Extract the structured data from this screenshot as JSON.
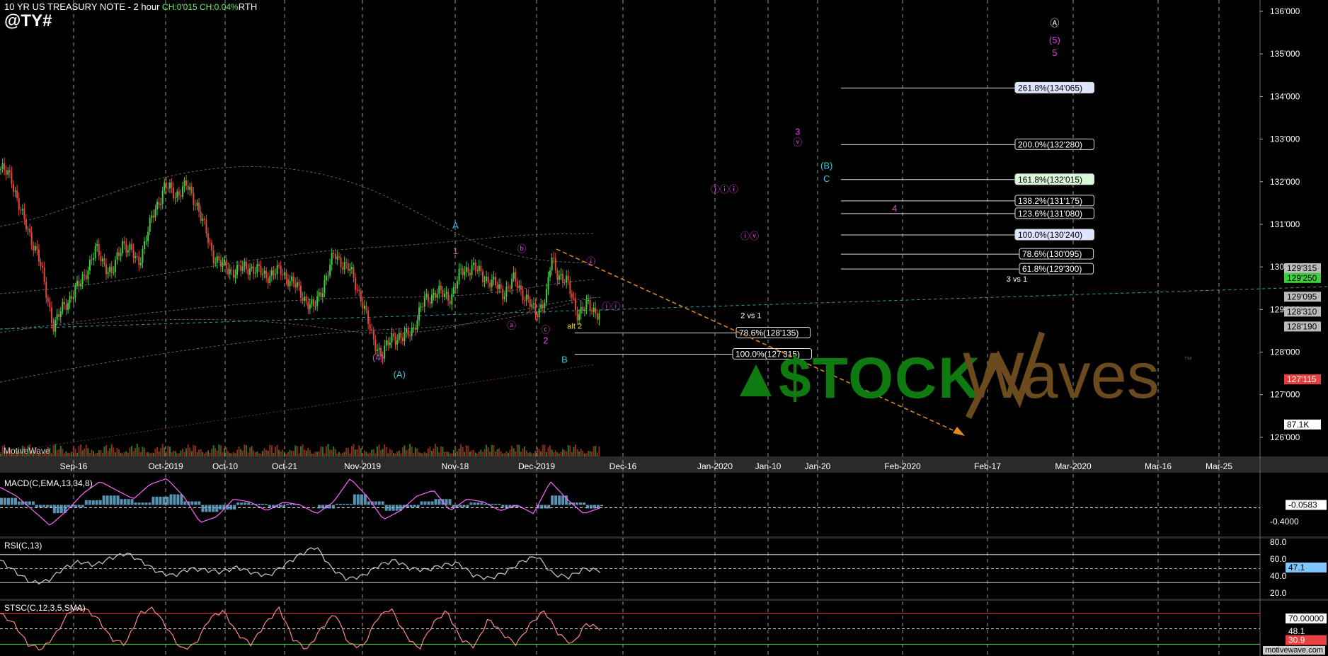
{
  "header": {
    "instrument": "10 YR US TREASURY NOTE - 2 hour",
    "change": "CH:0'015 CH:0.04%",
    "session": "RTH",
    "symbol": "@TY#"
  },
  "branding": {
    "platform": "MotiveWave",
    "footer": "motivewave.com"
  },
  "watermark": {
    "part1": "$TOCK",
    "part2": "Waves",
    "tm": "™",
    "color_green": "#0f7a0f",
    "color_brown": "#6b4a1e"
  },
  "colors": {
    "bg": "#000000",
    "up": "#3ecf3e",
    "down": "#e2473a",
    "grid": "#bfbfbf",
    "magenta": "#e040e0",
    "cyan": "#30c8e0",
    "orange": "#e88a1a",
    "yellow": "#f0e020"
  },
  "chart_data": [
    {
      "type": "candlestick",
      "title": "",
      "x_ticks": [
        "Sep-16",
        "Oct-2019",
        "Oct-10",
        "Oct-21",
        "Nov-2019",
        "Nov-18",
        "Dec-2019",
        "Dec-16",
        "Jan-2020",
        "Jan-10",
        "Jan-20",
        "Feb-2020",
        "Feb-17",
        "Mar-2020",
        "Mar-16",
        "Mar-25"
      ],
      "y_ticks": [
        "136'000",
        "135'000",
        "134'000",
        "133'000",
        "132'000",
        "131'000",
        "130'000",
        "129'000",
        "128'000",
        "127'000",
        "126'000"
      ],
      "ylim": [
        125.6,
        136.1
      ],
      "close_path": [
        [
          0,
          132.3
        ],
        [
          2,
          132.1
        ],
        [
          4,
          131.2
        ],
        [
          7,
          130.3
        ],
        [
          10,
          128.6
        ],
        [
          12,
          129.1
        ],
        [
          15,
          129.6
        ],
        [
          18,
          130.4
        ],
        [
          21,
          129.8
        ],
        [
          23,
          130.6
        ],
        [
          26,
          130.1
        ],
        [
          29,
          131.3
        ],
        [
          31,
          131.9
        ],
        [
          33,
          131.7
        ],
        [
          35,
          131.9
        ],
        [
          37,
          131.5
        ],
        [
          40,
          130.3
        ],
        [
          42,
          130.0
        ],
        [
          44,
          129.9
        ],
        [
          47,
          130.0
        ],
        [
          50,
          129.8
        ],
        [
          53,
          129.9
        ],
        [
          56,
          129.5
        ],
        [
          59,
          129.0
        ],
        [
          61,
          129.6
        ],
        [
          63,
          130.3
        ],
        [
          66,
          129.9
        ],
        [
          68,
          129.3
        ],
        [
          70,
          128.4
        ],
        [
          72,
          127.9
        ],
        [
          74,
          128.4
        ],
        [
          76,
          128.3
        ],
        [
          78,
          128.6
        ],
        [
          80,
          129.2
        ],
        [
          82,
          129.4
        ],
        [
          85,
          129.3
        ],
        [
          87,
          129.9
        ],
        [
          89,
          130.0
        ],
        [
          92,
          129.7
        ],
        [
          95,
          129.4
        ],
        [
          97,
          129.7
        ],
        [
          99,
          129.3
        ],
        [
          101,
          128.9
        ],
        [
          103,
          129.3
        ],
        [
          104,
          130.2
        ],
        [
          105,
          129.9
        ],
        [
          107,
          129.6
        ],
        [
          109,
          128.9
        ],
        [
          111,
          129.1
        ],
        [
          113,
          128.9
        ]
      ],
      "levels": [
        {
          "label": "261.8%(134'065)",
          "price": 134.2,
          "bg": "#dde4ff"
        },
        {
          "label": "200.0%(132'280)",
          "price": 132.87,
          "bg": "#000"
        },
        {
          "label": "161.8%(132'015)",
          "price": 132.05,
          "bg": "#d8f8d8"
        },
        {
          "label": "138.2%(131'175)",
          "price": 131.55,
          "bg": "#000"
        },
        {
          "label": "123.6%(131'080)",
          "price": 131.25,
          "bg": "#000"
        },
        {
          "label": "100.0%(130'240)",
          "price": 130.75,
          "bg": "#dde4ff"
        },
        {
          "label": "78.6%(130'095)",
          "price": 130.3,
          "bg": "#000"
        },
        {
          "label": "61.8%(129'300)",
          "price": 129.95,
          "bg": "#000"
        },
        {
          "label": "78.6%(128'135)",
          "price": 128.45,
          "bg": "#000"
        },
        {
          "label": "100.0%(127'315)",
          "price": 127.95,
          "bg": "#000"
        }
      ],
      "price_badges": [
        {
          "label": "129'315",
          "price": 129.97,
          "bg": "#bbbbbb",
          "fg": "#000"
        },
        {
          "label": "129'250",
          "price": 129.74,
          "bg": "#3ecf3e",
          "fg": "#000"
        },
        {
          "label": "129'095",
          "price": 129.3,
          "bg": "#bbbbbb",
          "fg": "#000"
        },
        {
          "label": "128'310",
          "price": 128.95,
          "bg": "#bbbbbb",
          "fg": "#000"
        },
        {
          "label": "128'190",
          "price": 128.6,
          "bg": "#bbbbbb",
          "fg": "#000"
        },
        {
          "label": "127'115",
          "price": 127.36,
          "bg": "#e84040",
          "fg": "#fff"
        },
        {
          "label": "87.1K",
          "price": 126.3,
          "bg": "#fff",
          "fg": "#000"
        }
      ],
      "annotations": [
        {
          "text": "A",
          "price": 130.9,
          "x": 0.3615,
          "color": "#30c8e0"
        },
        {
          "text": "1",
          "price": 130.3,
          "x": 0.3615,
          "color": "#e040e0"
        },
        {
          "text": "(4)",
          "price": 127.8,
          "x": 0.3,
          "color": "#e040e0"
        },
        {
          "text": "(A)",
          "price": 127.4,
          "x": 0.317,
          "color": "#30c8e0"
        },
        {
          "text": "ⓑ",
          "price": 130.35,
          "x": 0.414,
          "color": "#e040e0"
        },
        {
          "text": "ⓐ",
          "price": 128.55,
          "x": 0.406,
          "color": "#e040e0"
        },
        {
          "text": "ⓒ",
          "price": 128.45,
          "x": 0.433,
          "color": "#e040e0"
        },
        {
          "text": "2",
          "price": 128.2,
          "x": 0.433,
          "color": "#e040e0"
        },
        {
          "text": "B",
          "price": 127.75,
          "x": 0.448,
          "color": "#30c8e0"
        },
        {
          "text": "alt 2",
          "price": 128.55,
          "x": 0.456,
          "color": "#f0e020"
        },
        {
          "text": "ⓘ",
          "price": 130.05,
          "x": 0.469,
          "color": "#e040e0"
        },
        {
          "text": "ⓘⓘ",
          "price": 129.0,
          "x": 0.485,
          "color": "#e040e0"
        },
        {
          "text": "2 vs 1",
          "price": 128.8,
          "x": 0.596,
          "color": "#ffffff"
        },
        {
          "text": "ⓘⓘⓘ",
          "price": 131.75,
          "x": 0.575,
          "color": "#e040e0"
        },
        {
          "text": "ⓘⓥ",
          "price": 130.65,
          "x": 0.595,
          "color": "#e040e0"
        },
        {
          "text": "3",
          "price": 133.1,
          "x": 0.633,
          "color": "#e040e0"
        },
        {
          "text": "ⓥ",
          "price": 132.85,
          "x": 0.633,
          "color": "#e040e0"
        },
        {
          "text": "(B)",
          "price": 132.3,
          "x": 0.656,
          "color": "#30c8e0"
        },
        {
          "text": "C",
          "price": 132.0,
          "x": 0.656,
          "color": "#30c8e0"
        },
        {
          "text": "4",
          "price": 131.3,
          "x": 0.71,
          "color": "#e040e0"
        },
        {
          "text": "3 vs 1",
          "price": 129.65,
          "x": 0.807,
          "color": "#ffffff"
        },
        {
          "text": "Ⓐ",
          "price": 135.65,
          "x": 0.837,
          "color": "#ffffff"
        },
        {
          "text": "(5)",
          "price": 135.25,
          "x": 0.837,
          "color": "#e040e0"
        },
        {
          "text": "5",
          "price": 134.95,
          "x": 0.837,
          "color": "#e040e0"
        }
      ]
    },
    {
      "type": "line",
      "title": "MACD(C,EMA,13,34,8)",
      "y_ticks": [
        "-0.4000"
      ],
      "y_labels_extra": [
        {
          "label": "-0.0583",
          "pos": 0.5,
          "bg": "#fff",
          "fg": "#000"
        }
      ],
      "series": [
        {
          "values": [
            0.6,
            0.3,
            -0.2,
            -0.7,
            -0.2,
            0.4,
            0.8,
            0.5,
            0.2,
            0.7,
            0.9,
            0.3,
            -0.6,
            -0.4,
            0.2,
            0.1,
            -0.2,
            0.1,
            0.0,
            -0.3,
            0.1,
            0.9,
            0.3,
            -0.5,
            -0.2,
            0.3,
            0.5,
            -0.2,
            0.2,
            0.1,
            -0.2,
            0.0,
            -0.3,
            0.8,
            0.2,
            -0.3,
            -0.1
          ]
        }
      ]
    },
    {
      "type": "line",
      "title": "RSI(C,13)",
      "y_ticks": [
        "80.0",
        "60.0",
        "40.0",
        "20.0"
      ],
      "ylim": [
        10,
        90
      ],
      "y_labels_extra": [
        {
          "label": "47.1",
          "pos": 0.48,
          "bg": "#7ec8ff",
          "fg": "#000"
        }
      ],
      "series": [
        {
          "values": [
            62,
            45,
            30,
            32,
            50,
            60,
            55,
            65,
            72,
            60,
            45,
            40,
            50,
            48,
            45,
            52,
            44,
            40,
            55,
            70,
            82,
            50,
            35,
            40,
            55,
            62,
            50,
            48,
            55,
            58,
            40,
            36,
            45,
            60,
            68,
            42,
            38,
            50,
            47
          ]
        }
      ]
    },
    {
      "type": "line",
      "title": "STSC(C,12,3,5,SMA)",
      "y_ticks": [
        "70.00000"
      ],
      "ylim": [
        0,
        100
      ],
      "y_labels_extra": [
        {
          "label": "70.00000",
          "pos": 0.3,
          "bg": "#fff",
          "fg": "#000"
        },
        {
          "label": "48.1",
          "pos": 0.55,
          "bg": "#000",
          "fg": "#fff"
        },
        {
          "label": "30.9",
          "pos": 0.72,
          "bg": "#e84040",
          "fg": "#fff"
        }
      ],
      "series": [
        {
          "values": [
            80,
            60,
            20,
            10,
            40,
            85,
            90,
            70,
            30,
            20,
            80,
            90,
            50,
            10,
            20,
            70,
            85,
            40,
            20,
            60,
            90,
            30,
            10,
            50,
            80,
            20,
            15,
            70,
            90,
            40,
            10,
            60,
            85,
            30,
            15,
            70,
            40,
            20,
            60,
            85,
            40,
            20,
            60,
            50
          ]
        }
      ]
    }
  ]
}
